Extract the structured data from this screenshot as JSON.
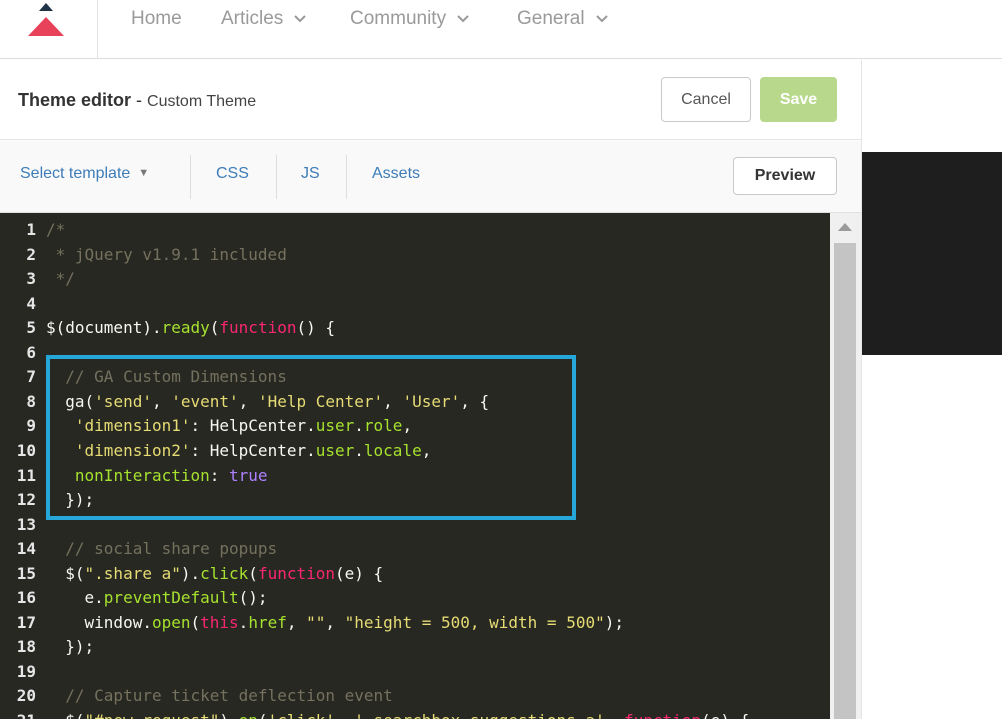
{
  "nav": {
    "home": "Home",
    "articles": "Articles",
    "community": "Community",
    "general": "General"
  },
  "header": {
    "title": "Theme editor",
    "separator": " - ",
    "subtitle": "Custom Theme",
    "cancel_label": "Cancel",
    "save_label": "Save"
  },
  "toolbar": {
    "select_template": "Select template",
    "css": "CSS",
    "js": "JS",
    "assets": "Assets",
    "preview_label": "Preview"
  },
  "colors": {
    "comment": "#75715e",
    "string": "#e6db74",
    "keyword": "#f92672",
    "function": "#a6e22e",
    "constant": "#ae81ff",
    "highlight": "#25a7d9",
    "save_button": "#b8d88b"
  },
  "code_lines": [
    {
      "n": "1",
      "tokens": [
        [
          "c",
          "/*"
        ]
      ]
    },
    {
      "n": "2",
      "tokens": [
        [
          "c",
          " * jQuery v1.9.1 included"
        ]
      ]
    },
    {
      "n": "3",
      "tokens": [
        [
          "c",
          " */"
        ]
      ]
    },
    {
      "n": "4",
      "tokens": []
    },
    {
      "n": "5",
      "tokens": [
        [
          "p",
          "$(document)."
        ],
        [
          "f",
          "ready"
        ],
        [
          "p",
          "("
        ],
        [
          "k",
          "function"
        ],
        [
          "p",
          "() {"
        ]
      ]
    },
    {
      "n": "6",
      "tokens": []
    },
    {
      "n": "7",
      "tokens": [
        [
          "c",
          "  // GA Custom Dimensions"
        ]
      ]
    },
    {
      "n": "8",
      "tokens": [
        [
          "p",
          "  ga("
        ],
        [
          "s",
          "'send'"
        ],
        [
          "p",
          ", "
        ],
        [
          "s",
          "'event'"
        ],
        [
          "p",
          ", "
        ],
        [
          "s",
          "'Help Center'"
        ],
        [
          "p",
          ", "
        ],
        [
          "s",
          "'User'"
        ],
        [
          "p",
          ", {"
        ]
      ]
    },
    {
      "n": "9",
      "tokens": [
        [
          "p",
          "   "
        ],
        [
          "s",
          "'dimension1'"
        ],
        [
          "p",
          ": HelpCenter."
        ],
        [
          "f",
          "user"
        ],
        [
          "p",
          "."
        ],
        [
          "f",
          "role"
        ],
        [
          "p",
          ","
        ]
      ]
    },
    {
      "n": "10",
      "tokens": [
        [
          "p",
          "   "
        ],
        [
          "s",
          "'dimension2'"
        ],
        [
          "p",
          ": HelpCenter."
        ],
        [
          "f",
          "user"
        ],
        [
          "p",
          "."
        ],
        [
          "f",
          "locale"
        ],
        [
          "p",
          ","
        ]
      ]
    },
    {
      "n": "11",
      "tokens": [
        [
          "p",
          "   "
        ],
        [
          "f",
          "nonInteraction"
        ],
        [
          "p",
          ": "
        ],
        [
          "v",
          "true"
        ]
      ]
    },
    {
      "n": "12",
      "tokens": [
        [
          "p",
          "  });"
        ]
      ]
    },
    {
      "n": "13",
      "tokens": []
    },
    {
      "n": "14",
      "tokens": [
        [
          "c",
          "  // social share popups"
        ]
      ]
    },
    {
      "n": "15",
      "tokens": [
        [
          "p",
          "  $("
        ],
        [
          "s",
          "\".share a\""
        ],
        [
          "p",
          ")."
        ],
        [
          "f",
          "click"
        ],
        [
          "p",
          "("
        ],
        [
          "k",
          "function"
        ],
        [
          "p",
          "(e) {"
        ]
      ]
    },
    {
      "n": "16",
      "tokens": [
        [
          "p",
          "    e."
        ],
        [
          "f",
          "preventDefault"
        ],
        [
          "p",
          "();"
        ]
      ]
    },
    {
      "n": "17",
      "tokens": [
        [
          "p",
          "    window."
        ],
        [
          "f",
          "open"
        ],
        [
          "p",
          "("
        ],
        [
          "k",
          "this"
        ],
        [
          "p",
          "."
        ],
        [
          "f",
          "href"
        ],
        [
          "p",
          ", "
        ],
        [
          "s",
          "\"\""
        ],
        [
          "p",
          ", "
        ],
        [
          "s",
          "\"height = 500, width = 500\""
        ],
        [
          "p",
          ");"
        ]
      ]
    },
    {
      "n": "18",
      "tokens": [
        [
          "p",
          "  });"
        ]
      ]
    },
    {
      "n": "19",
      "tokens": []
    },
    {
      "n": "20",
      "tokens": [
        [
          "c",
          "  // Capture ticket deflection event"
        ]
      ]
    },
    {
      "n": "21",
      "tokens": [
        [
          "p",
          "  $("
        ],
        [
          "s",
          "\"#new_request\""
        ],
        [
          "p",
          ")."
        ],
        [
          "f",
          "on"
        ],
        [
          "p",
          "("
        ],
        [
          "s",
          "'click'"
        ],
        [
          "p",
          ", "
        ],
        [
          "s",
          "'.searchbox-suggestions a'"
        ],
        [
          "p",
          ", "
        ],
        [
          "k",
          "function"
        ],
        [
          "p",
          "(e) {"
        ]
      ]
    }
  ]
}
